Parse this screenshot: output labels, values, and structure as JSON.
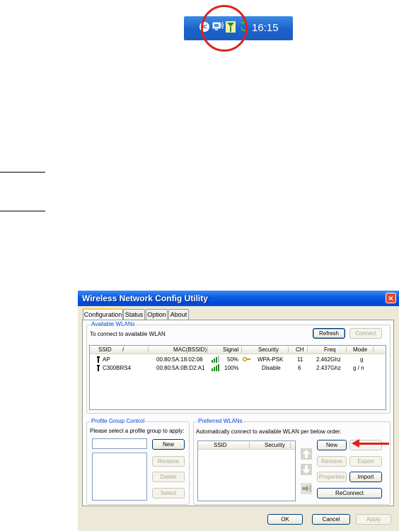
{
  "tray": {
    "time": "16:15",
    "chevron": "<",
    "icons": [
      "chevron-left-icon",
      "network-monitor-icon",
      "wireless-signal-icon",
      "refresh-arrows-icon"
    ]
  },
  "window": {
    "title": "Wireless Network Config Utility",
    "close": "×",
    "tabs": [
      "Configuration",
      "Status",
      "Option",
      "About"
    ],
    "available": {
      "label": "Available WLANs",
      "instruction": "To connect to available WLAN",
      "refresh": "Refresh",
      "connect": "Connect",
      "columns": [
        "SSID",
        "MAC(BSSID)",
        "Signal",
        "Security",
        "CH",
        "Freq",
        "Mode"
      ],
      "sort_indicator": "/",
      "rows": [
        {
          "ssid": "AP",
          "mac": "00:80:5A:18:02:08",
          "signal": "50%",
          "security": "WPA-PSK",
          "ch": "11",
          "freq": "2.462Ghz",
          "mode": "g"
        },
        {
          "ssid": "C300BRS4",
          "mac": "00:80:5A:0B:D2:A1",
          "signal": "100%",
          "security": "Disable",
          "ch": "6",
          "freq": "2.437Ghz",
          "mode": "g / n"
        }
      ]
    },
    "profile_group": {
      "label": "Profile Group Control",
      "instruction": "Please select a profile group to apply:",
      "input_value": "",
      "new": "New",
      "rename": "Rename",
      "delete": "Delete",
      "select": "Select"
    },
    "preferred": {
      "label": "Preferred WLANs",
      "instruction": "Automatically connect to available WLAN per below order.",
      "columns": [
        "SSID",
        "Security"
      ],
      "new": "New",
      "remove": "Remove",
      "export": "Export",
      "properties": "Properties",
      "import": "Import",
      "reconnect": "ReConnect",
      "up": "↑",
      "down": "↓",
      "goto": "→"
    },
    "footer": {
      "ok": "OK",
      "cancel": "Cancel",
      "apply": "Apply"
    }
  },
  "colors": {
    "annotation_red": "#e0201c",
    "titlebar_blue": "#0a5ee3",
    "group_label_blue": "#0046d5"
  }
}
